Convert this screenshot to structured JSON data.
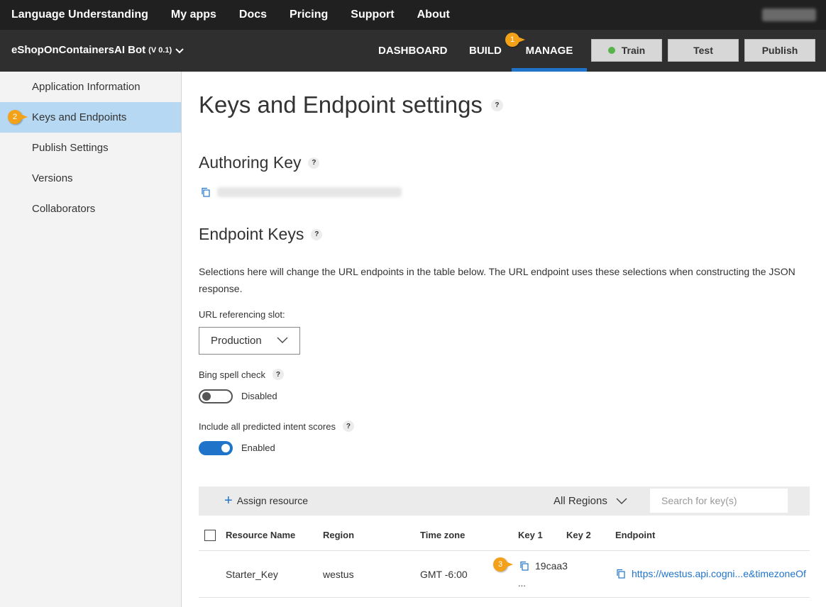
{
  "topnav": {
    "items": [
      "Language Understanding",
      "My apps",
      "Docs",
      "Pricing",
      "Support",
      "About"
    ]
  },
  "appbar": {
    "app_name": "eShopOnContainersAI Bot",
    "version": "(V 0.1)",
    "tabs": {
      "dashboard": "DASHBOARD",
      "build": "BUILD",
      "manage": "MANAGE"
    },
    "buttons": {
      "train": "Train",
      "test": "Test",
      "publish": "Publish"
    }
  },
  "badges": {
    "manage": "1",
    "keys": "2",
    "copy": "3"
  },
  "sidebar": {
    "items": [
      "Application Information",
      "Keys and Endpoints",
      "Publish Settings",
      "Versions",
      "Collaborators"
    ],
    "active_index": 1
  },
  "main": {
    "title": "Keys and Endpoint settings",
    "help": "?",
    "authoring_key_heading": "Authoring Key",
    "endpoint_keys_heading": "Endpoint Keys",
    "description": "Selections here will change the URL endpoints in the table below. The URL endpoint uses these selections when constructing the JSON response.",
    "slot_label": "URL referencing slot:",
    "slot_value": "Production",
    "bing_label": "Bing spell check",
    "bing_state": "Disabled",
    "scores_label": "Include all predicted intent scores",
    "scores_state": "Enabled"
  },
  "toolbar": {
    "assign": "Assign resource",
    "regions": "All Regions",
    "search_placeholder": "Search for key(s)"
  },
  "table": {
    "headers": [
      "Resource Name",
      "Region",
      "Time zone",
      "Key 1",
      "Key 2",
      "Endpoint"
    ],
    "rows": [
      {
        "resource_name": "Starter_Key",
        "region": "westus",
        "time_zone": "GMT -6:00",
        "key1": "19caa3",
        "key1_more": "...",
        "endpoint": "https://westus.api.cogni...e&timezoneOf"
      }
    ]
  },
  "colors": {
    "accent": "#1f74c9",
    "active_bg": "#b6d8f2",
    "badge": "#f4a11a",
    "train_dot": "#57b44b"
  }
}
